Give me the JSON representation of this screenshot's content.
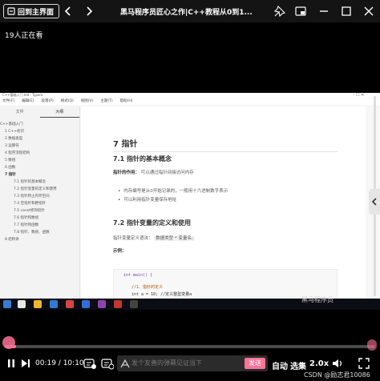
{
  "header": {
    "back_label": "回到主界面",
    "video_title": "黑马程序员匠心之作|C++教程从0到1..."
  },
  "viewer_count": "19人正在看",
  "app": {
    "title": "C++基础入门.md - Typora",
    "menu": [
      "文件(F)",
      "编辑(E)",
      "段落(P)",
      "格式(O)",
      "视图(V)",
      "主题(T)",
      "帮助(H)"
    ],
    "sidebar_tabs": [
      "文件",
      "大纲"
    ],
    "toc": [
      {
        "label": "C++基础入门",
        "level": 0
      },
      {
        "label": "1 C++初识",
        "level": 1
      },
      {
        "label": "2 数据类型",
        "level": 1
      },
      {
        "label": "3 运算符",
        "level": 1
      },
      {
        "label": "4 程序流程结构",
        "level": 1
      },
      {
        "label": "5 数组",
        "level": 1
      },
      {
        "label": "6 函数",
        "level": 1
      },
      {
        "label": "7 指针",
        "level": 1
      },
      {
        "label": "7.1 指针的基本概念",
        "level": 2
      },
      {
        "label": "7.2 指针变量的定义和使用",
        "level": 2
      },
      {
        "label": "7.3 指针所占内存空间",
        "level": 2
      },
      {
        "label": "7.4 空指针和野指针",
        "level": 2
      },
      {
        "label": "7.5 const修饰指针",
        "level": 2
      },
      {
        "label": "7.6 指针和数组",
        "level": 2
      },
      {
        "label": "7.7 指针和函数",
        "level": 2
      },
      {
        "label": "7.8 指针、数组、函数",
        "level": 2
      },
      {
        "label": "8 结构体",
        "level": 1
      }
    ],
    "doc": {
      "h1": "7 指针",
      "h2_1": "7.1 指针的基本概念",
      "purpose_label": "指针的作用：",
      "purpose_text": "可以通过指针间接访问内存",
      "bullets": [
        "内存编号是从0开始记录的，一般用十六进制数字表示",
        "可以利用指针变量保存地址"
      ],
      "h2_2": "7.2 指针变量的定义和使用",
      "syntax_label": "指针变量定义语法：",
      "syntax_code": "数据类型 * 变量名;",
      "example_label": "示例：",
      "code_lines": [
        "int main() {",
        "//1、指针的定义",
        "int a = 10; //定义整型变量a"
      ]
    }
  },
  "watermark": "黑马程序员",
  "player": {
    "time_current": "00:19",
    "time_total": "10:10",
    "progress_fraction": 0.031,
    "danmaku_placeholder": "发个友善的弹幕见证当下",
    "send_label": "发送",
    "auto_label": "自动",
    "episodes_label": "选集",
    "speed_label": "2.0x",
    "source": "CSDN @励志君10086"
  },
  "colors": {
    "accent": "#fb7299",
    "topbar": "#141414"
  }
}
